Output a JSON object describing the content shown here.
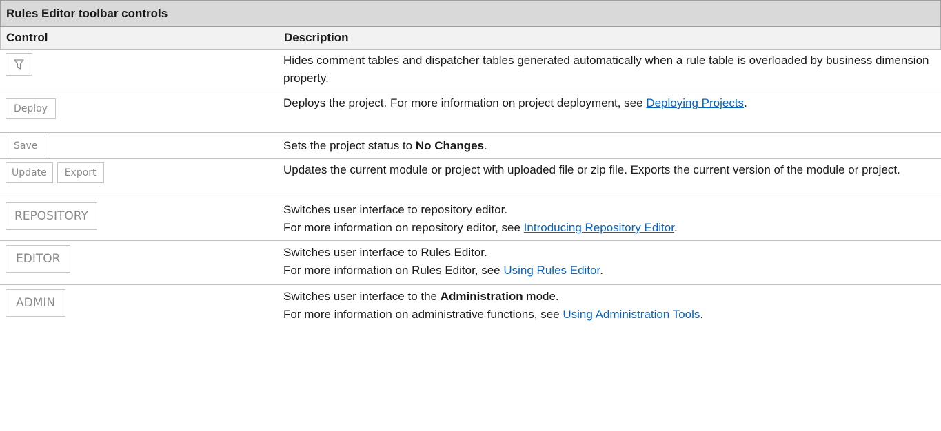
{
  "title": "Rules Editor toolbar controls",
  "headers": {
    "control": "Control",
    "description": "Description"
  },
  "rows": [
    {
      "controls": [
        {
          "icon": "filter-icon"
        }
      ],
      "description": "Hides comment tables and dispatcher tables generated automatically when a rule table is overloaded by business dimension property."
    },
    {
      "controls": [
        {
          "label": "Deploy"
        }
      ],
      "desc_pre": "Deploys the project. For more information on project deployment, see ",
      "link": "Deploying Projects",
      "desc_post": "."
    },
    {
      "controls": [
        {
          "label": "Save"
        }
      ],
      "desc_pre": "Sets the project status to ",
      "bold": "No Changes",
      "desc_post": "."
    },
    {
      "controls": [
        {
          "label": "Update"
        },
        {
          "label": "Export"
        }
      ],
      "description": "Updates the current module or project with uploaded file or zip file. Exports the current version of the module or project."
    },
    {
      "controls": [
        {
          "label": "REPOSITORY"
        }
      ],
      "line1": "Switches user interface to repository editor.",
      "line2_pre": "For more information on repository editor, see ",
      "link": "Introducing Repository Editor",
      "line2_post": "."
    },
    {
      "controls": [
        {
          "label": "EDITOR"
        }
      ],
      "line1": "Switches user interface to Rules Editor.",
      "line2_pre": "For more information on Rules Editor, see ",
      "link": "Using Rules Editor",
      "line2_post": "."
    },
    {
      "controls": [
        {
          "label": "ADMIN"
        }
      ],
      "line1_pre": "Switches user interface to the ",
      "line1_bold": "Administration",
      "line1_post": " mode.",
      "line2_pre": "For more information on administrative functions, see ",
      "link": "Using Administration Tools",
      "line2_post": "."
    }
  ]
}
